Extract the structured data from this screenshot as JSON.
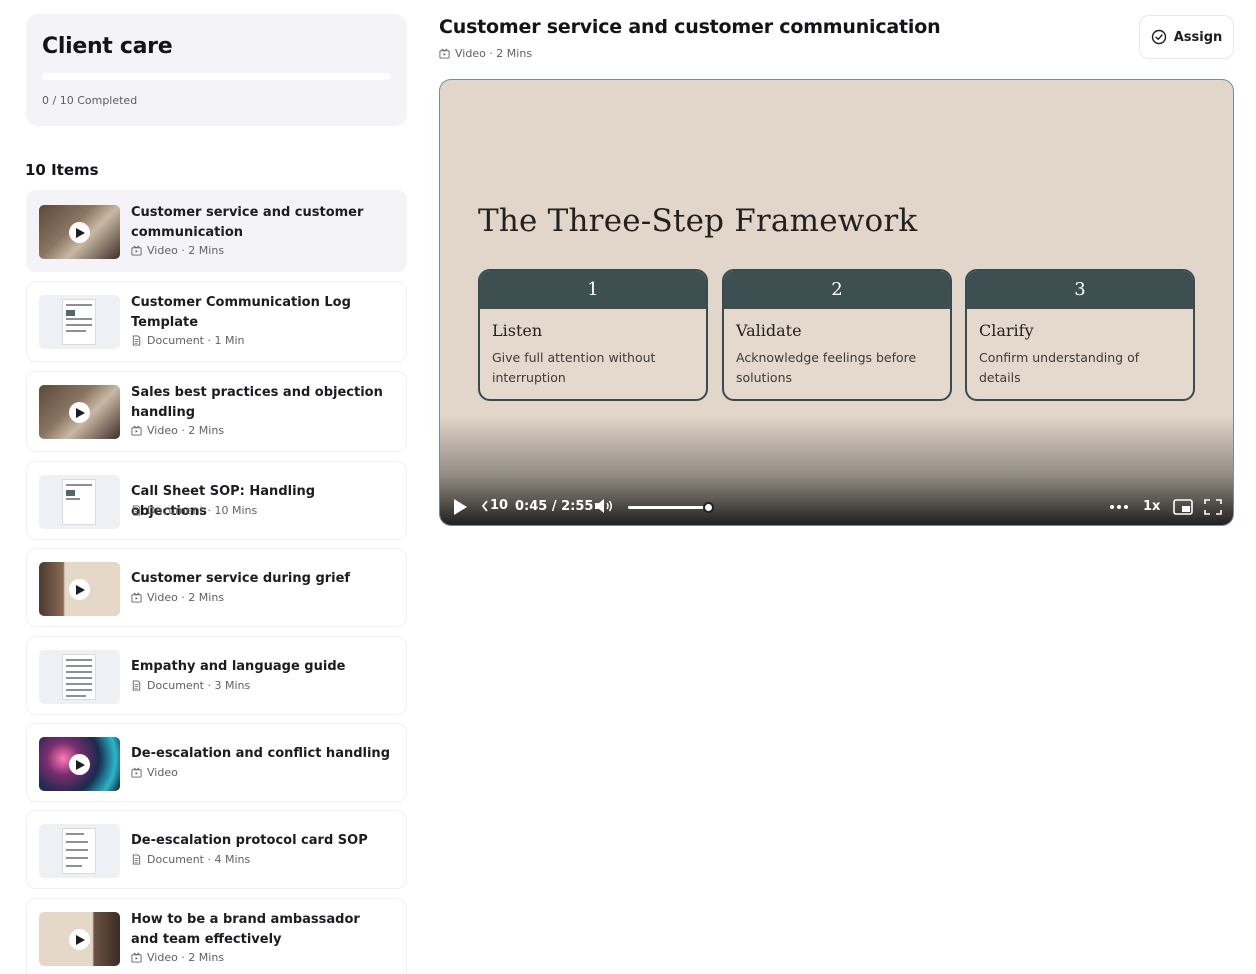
{
  "sidebar": {
    "course_title": "Client care",
    "progress_fraction": 0,
    "progress_text": "0 / 10 Completed",
    "items_heading": "10 Items",
    "items": [
      {
        "title": "Customer service and customer communication",
        "type": "Video",
        "duration": "Video · 2 Mins",
        "active": true
      },
      {
        "title": "Customer Communication Log Template",
        "type": "Document",
        "duration": "Document · 1 Min"
      },
      {
        "title": "Sales best practices and objection handling",
        "type": "Video",
        "duration": "Video · 2 Mins"
      },
      {
        "title": "Call Sheet SOP: Handling objections",
        "type": "Document",
        "duration": "Document · 10 Mins"
      },
      {
        "title": "Customer service during grief",
        "type": "Video",
        "duration": "Video · 2 Mins"
      },
      {
        "title": "Empathy and language guide",
        "type": "Document",
        "duration": "Document · 3 Mins"
      },
      {
        "title": "De-escalation and conflict handling",
        "type": "Video",
        "duration": "Video"
      },
      {
        "title": "De-escalation protocol card SOP",
        "type": "Document",
        "duration": "Document · 4 Mins"
      },
      {
        "title": "How to be a brand ambassador and team effectively",
        "type": "Video",
        "duration": "Video · 2 Mins"
      }
    ]
  },
  "main": {
    "title": "Customer service and customer communication",
    "meta": "Video · 2 Mins",
    "assign_label": "Assign"
  },
  "player": {
    "slide_heading": "The Three-Step Framework",
    "steps": [
      {
        "number": "1",
        "name": "Listen",
        "description": "Give full attention without interruption"
      },
      {
        "number": "2",
        "name": "Validate",
        "description": "Acknowledge feelings before solutions"
      },
      {
        "number": "3",
        "name": "Clarify",
        "description": "Confirm understanding of details"
      }
    ],
    "rewind_label": "10",
    "time": "0:45 / 2:55",
    "volume_fraction": 1,
    "speed": "1x"
  },
  "colors": {
    "accent": "#3d4f51",
    "slide_bg": "#e1d6c9",
    "active_item_bg": "#f4f4f8"
  }
}
